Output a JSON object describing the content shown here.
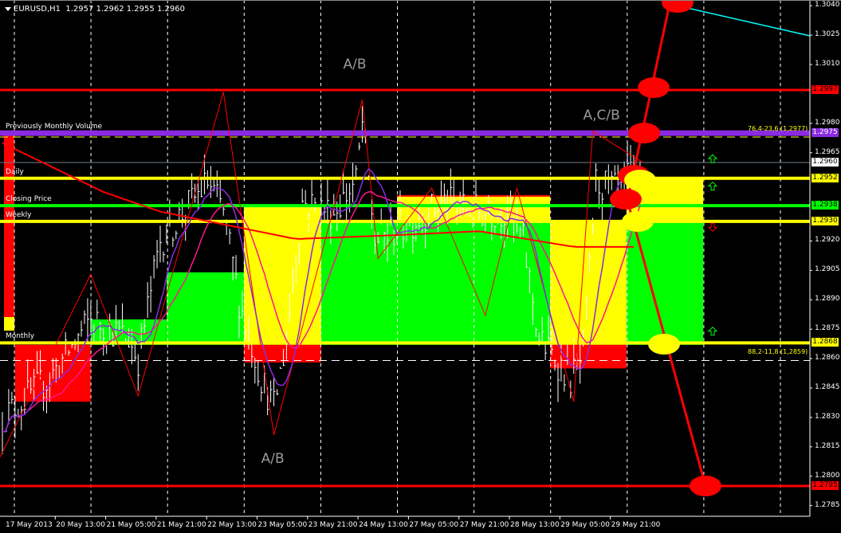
{
  "header": {
    "symbol": "EURUSD,H1",
    "open": "1.2957",
    "high": "1.2962",
    "low": "1.2955",
    "close": "1.2960"
  },
  "level_labels": [
    {
      "text": "Previously Monthly Volume",
      "price": 1.2975
    },
    {
      "text": "Daily",
      "price": 1.2952
    },
    {
      "text": "Closing Price",
      "price": 1.2938
    },
    {
      "text": "Weekly",
      "price": 1.293
    },
    {
      "text": "Monthly",
      "price": 1.2868
    }
  ],
  "annotations": [
    {
      "text": "A/B",
      "bar": 111,
      "price": 1.301
    },
    {
      "text": "A,C/B",
      "bar": 187,
      "price": 1.2984
    },
    {
      "text": "A/B",
      "bar": 85,
      "price": 1.2809
    }
  ],
  "fib_labels": [
    {
      "text": "76,4-23,6 (1,2977)",
      "price": 1.2976
    },
    {
      "text": "88,2-11,8 (1,2859)",
      "price": 1.2862
    }
  ],
  "price_axis": {
    "ticks": [
      "1.3040",
      "1.3025",
      "1.3010",
      "1.2980",
      "1.2965",
      "1.2920",
      "1.2905",
      "1.2890",
      "1.2875",
      "1.2860",
      "1.2845",
      "1.2830",
      "1.2815",
      "1.2800",
      "1.2785"
    ],
    "markers": [
      {
        "text": "1.2997",
        "bg": "#ff0000",
        "fg": "#000000"
      },
      {
        "text": "1.2975",
        "bg": "#8a2be2",
        "fg": "#ffffff"
      },
      {
        "text": "1.2960",
        "bg": "#ffffff",
        "fg": "#000000"
      },
      {
        "text": "1.2952",
        "bg": "#ffff00",
        "fg": "#000000"
      },
      {
        "text": "1.2938",
        "bg": "#00ff00",
        "fg": "#000000"
      },
      {
        "text": "1.2930",
        "bg": "#ffff00",
        "fg": "#000000"
      },
      {
        "text": "1.2868",
        "bg": "#ffff00",
        "fg": "#000000"
      },
      {
        "text": "1.2795",
        "bg": "#ff0000",
        "fg": "#000000"
      }
    ]
  },
  "time_axis": [
    "17 May 2013",
    "20 May 13:00",
    "21 May 05:00",
    "21 May 21:00",
    "22 May 13:00",
    "23 May 05:00",
    "23 May 21:00",
    "24 May 13:00",
    "27 May 05:00",
    "27 May 21:00",
    "28 May 13:00",
    "29 May 05:00",
    "29 May 21:00"
  ],
  "colors": {
    "bg": "#000000",
    "bars": "#ffffff",
    "red": "#ff0000",
    "yellow": "#ffff00",
    "green": "#00ff00",
    "purple": "#8a2be2",
    "magenta": "#ff1493",
    "cyan": "#00ffff"
  },
  "chart_data": {
    "type": "ohlc",
    "timeframe": "H1",
    "ylim": [
      1.278,
      1.3042
    ],
    "close_waypoints": [
      [
        0,
        1.283
      ],
      [
        15,
        1.285
      ],
      [
        28,
        1.288
      ],
      [
        40,
        1.287
      ],
      [
        43,
        1.286
      ],
      [
        50,
        1.292
      ],
      [
        65,
        1.295
      ],
      [
        70,
        1.2935
      ],
      [
        75,
        1.289
      ],
      [
        82,
        1.285
      ],
      [
        86,
        1.2835
      ],
      [
        90,
        1.287
      ],
      [
        95,
        1.294
      ],
      [
        105,
        1.2935
      ],
      [
        112,
        1.295
      ],
      [
        114,
        1.298
      ],
      [
        118,
        1.292
      ],
      [
        130,
        1.293
      ],
      [
        140,
        1.294
      ],
      [
        150,
        1.2935
      ],
      [
        160,
        1.2935
      ],
      [
        165,
        1.292
      ],
      [
        170,
        1.287
      ],
      [
        180,
        1.285
      ],
      [
        184,
        1.286
      ],
      [
        188,
        1.295
      ],
      [
        195,
        1.2945
      ],
      [
        202,
        1.296
      ]
    ],
    "long_ma_waypoints": [
      [
        0,
        1.297
      ],
      [
        32,
        1.2945
      ],
      [
        50,
        1.2935
      ],
      [
        93,
        1.2921
      ],
      [
        125,
        1.2923
      ],
      [
        151,
        1.2925
      ],
      [
        181,
        1.2917
      ],
      [
        201,
        1.2917
      ]
    ],
    "zigzag": [
      [
        -1,
        1.2809
      ],
      [
        28,
        1.2903
      ],
      [
        43,
        1.2841
      ],
      [
        70,
        1.2996
      ],
      [
        86,
        1.2821
      ],
      [
        114,
        1.2992
      ],
      [
        119,
        1.2911
      ],
      [
        136,
        1.2947
      ],
      [
        153,
        1.2882
      ],
      [
        163,
        1.2947
      ],
      [
        181,
        1.2838
      ],
      [
        187,
        1.2976
      ],
      [
        203,
        1.296
      ]
    ],
    "zones": [
      {
        "from": 4,
        "to": 28,
        "low": 1.2838,
        "high": 1.2867,
        "color": "red"
      },
      {
        "from": 28,
        "to": 52,
        "low": 1.2867,
        "high": 1.288,
        "color": "green"
      },
      {
        "from": 52,
        "to": 76.5,
        "low": 1.2867,
        "high": 1.2904,
        "color": "green"
      },
      {
        "from": 76.5,
        "to": 101,
        "low": 1.2867,
        "high": 1.2938,
        "color": "yellow"
      },
      {
        "from": 76.5,
        "to": 101,
        "low": 1.2858,
        "high": 1.2867,
        "color": "red"
      },
      {
        "from": 101,
        "to": 125,
        "low": 1.2867,
        "high": 1.293,
        "color": "green"
      },
      {
        "from": 125,
        "to": 173.5,
        "low": 1.2867,
        "high": 1.293,
        "color": "green"
      },
      {
        "from": 125,
        "to": 173.5,
        "low": 1.293,
        "high": 1.2943,
        "color": "yellow"
      },
      {
        "from": 173.5,
        "to": 197.7,
        "low": 1.2867,
        "high": 1.293,
        "color": "yellow"
      },
      {
        "from": 173.5,
        "to": 197.7,
        "low": 1.2855,
        "high": 1.2867,
        "color": "red"
      },
      {
        "from": 197.7,
        "to": 222,
        "low": 1.2867,
        "high": 1.293,
        "color": "green"
      },
      {
        "from": 197.7,
        "to": 222,
        "low": 1.293,
        "high": 1.2952,
        "color": "yellow"
      }
    ],
    "hlines": [
      {
        "price": 1.2997,
        "color": "red",
        "width": 3
      },
      {
        "price": 1.2975,
        "color": "purple",
        "width": 7
      },
      {
        "price": 1.2973,
        "color": "yellow",
        "width": 1,
        "dash": true
      },
      {
        "price": 1.296,
        "color": "#708090",
        "width": 1
      },
      {
        "price": 1.2952,
        "color": "yellow",
        "width": 4
      },
      {
        "price": 1.2938,
        "color": "green",
        "width": 4
      },
      {
        "price": 1.293,
        "color": "yellow",
        "width": 4
      },
      {
        "price": 1.2868,
        "color": "yellow",
        "width": 4
      },
      {
        "price": 1.2859,
        "color": "#ffffff",
        "width": 1,
        "dash": true
      },
      {
        "price": 1.2795,
        "color": "red",
        "width": 3
      }
    ],
    "arrows": [
      {
        "bar": 225,
        "price": 1.2962,
        "dir": "up"
      },
      {
        "bar": 225,
        "price": 1.2948,
        "dir": "up"
      },
      {
        "bar": 225,
        "price": 1.2927,
        "dir": "down"
      },
      {
        "bar": 225,
        "price": 1.2874,
        "dir": "up"
      }
    ]
  }
}
